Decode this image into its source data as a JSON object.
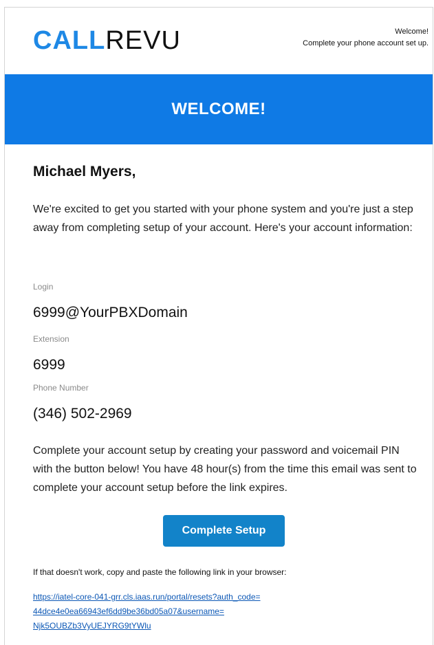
{
  "header": {
    "logo_part1": "CALL",
    "logo_part2": "REVU",
    "tagline_line1": "Welcome!",
    "tagline_line2": "Complete your phone account set up."
  },
  "banner": {
    "title": "WELCOME!"
  },
  "body": {
    "greeting": "Michael Myers,",
    "intro": "We're excited to get you started with your phone system and you're just a step away from completing setup of your account. Here's your account information:",
    "fields": [
      {
        "label": "Login",
        "value": "6999@YourPBXDomain"
      },
      {
        "label": "Extension",
        "value": "6999"
      },
      {
        "label": "Phone Number",
        "value": "(346) 502-2969"
      }
    ],
    "outro": "Complete your account setup by creating your password and voicemail PIN with the button below! You have 48 hour(s) from the time this email was sent to complete your account setup before the link expires.",
    "button_label": "Complete Setup",
    "fallback_text": "If that doesn't work, copy and paste the following link in your browser:",
    "link_lines": [
      "https://iatel-core-041-grr.cls.iaas.run/portal/resets?auth_code=",
      "44dce4e0ea66943ef6dd9be36bd05a07&username=",
      "Njk5OUBZb3VyUEJYRG9tYWlu"
    ]
  },
  "colors": {
    "brand_blue": "#1e88e5",
    "banner_blue": "#0f7ae5",
    "button_blue": "#1283c9",
    "link_blue": "#0b57b5"
  }
}
